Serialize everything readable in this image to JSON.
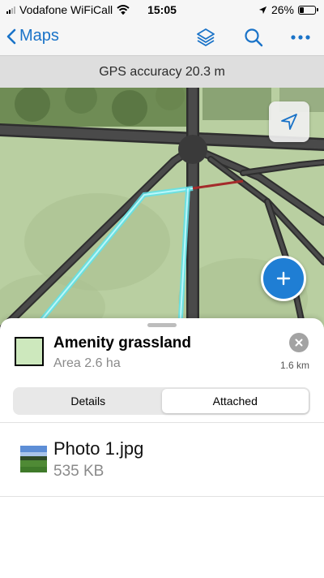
{
  "status_bar": {
    "carrier": "Vodafone WiFiCall",
    "time": "15:05",
    "battery": "26%"
  },
  "nav": {
    "back_label": "Maps"
  },
  "gps_banner": "GPS accuracy 20.3 m",
  "feature": {
    "title": "Amenity grassland",
    "subtitle": "Area 2.6 ha",
    "distance": "1.6 km",
    "symbol_color": "#cde8bd"
  },
  "tabs": [
    {
      "label": "Details",
      "selected": false
    },
    {
      "label": "Attached",
      "selected": true
    }
  ],
  "attachment": {
    "name": "Photo 1.jpg",
    "size": "535 KB"
  },
  "colors": {
    "accent": "#1a73c8",
    "fab": "#1f7ed4",
    "selection": "#5fe3ea",
    "map_green": "#b9cfa1",
    "road": "#3a3a3a"
  }
}
